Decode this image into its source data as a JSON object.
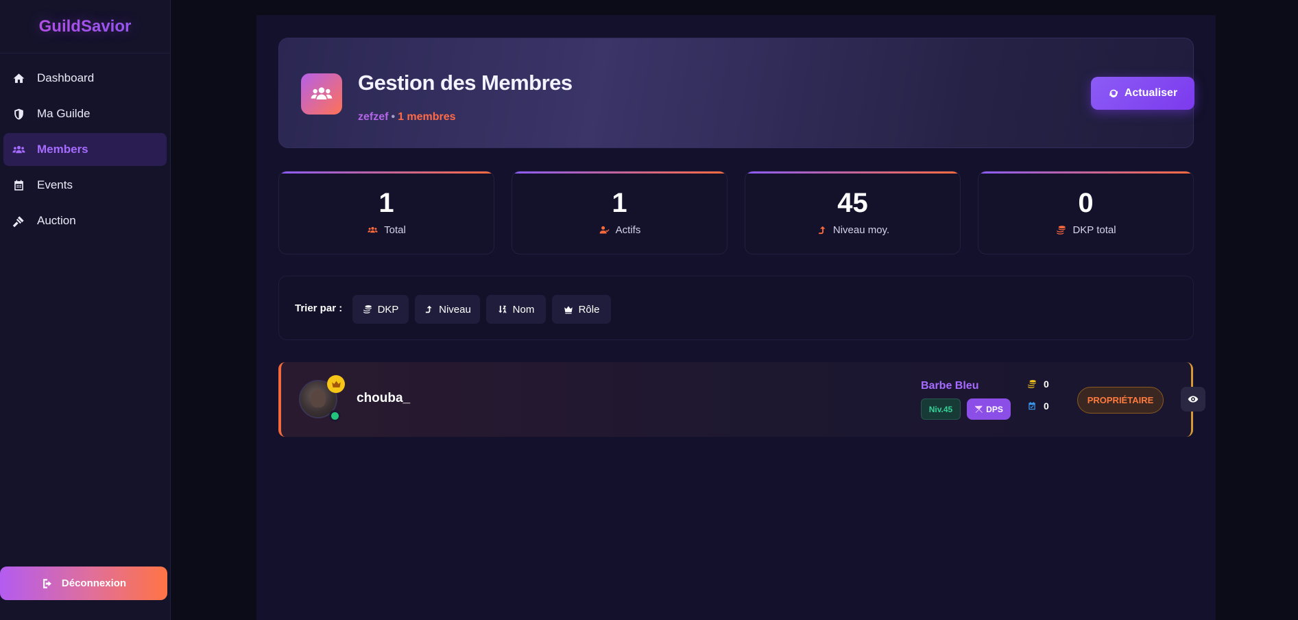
{
  "app": {
    "brand": "GuildSavior"
  },
  "sidebar": {
    "items": [
      {
        "label": "Dashboard",
        "icon": "home-icon"
      },
      {
        "label": "Ma Guilde",
        "icon": "shield-icon"
      },
      {
        "label": "Members",
        "icon": "users-icon",
        "active": true
      },
      {
        "label": "Events",
        "icon": "calendar-icon"
      },
      {
        "label": "Auction",
        "icon": "gavel-icon"
      }
    ],
    "logout_label": "Déconnexion"
  },
  "header": {
    "title": "Gestion des Membres",
    "guild": "zefzef",
    "separator": "•",
    "member_count": "1 membres",
    "refresh_label": "Actualiser"
  },
  "stats": [
    {
      "value": "1",
      "label": "Total",
      "icon": "users-icon"
    },
    {
      "value": "1",
      "label": "Actifs",
      "icon": "user-check-icon"
    },
    {
      "value": "45",
      "label": "Niveau moy.",
      "icon": "level-up-icon"
    },
    {
      "value": "0",
      "label": "DKP total",
      "icon": "coins-icon"
    }
  ],
  "sort": {
    "label": "Trier par :",
    "options": [
      {
        "label": "DKP",
        "icon": "coins-icon"
      },
      {
        "label": "Niveau",
        "icon": "level-up-icon"
      },
      {
        "label": "Nom",
        "icon": "sort-alpha-icon"
      },
      {
        "label": "Rôle",
        "icon": "crown-icon"
      }
    ]
  },
  "members": [
    {
      "username": "chouba_",
      "character": "Barbe Bleu",
      "level": "Niv.45",
      "role": "DPS",
      "dkp": "0",
      "events": "0",
      "rank": "PROPRIÉTAIRE",
      "online": true
    }
  ],
  "colors": {
    "accent": "#8b5cf6",
    "accent_orange": "#ff6b3d",
    "background": "#0c0b18",
    "panel": "#13112b"
  }
}
